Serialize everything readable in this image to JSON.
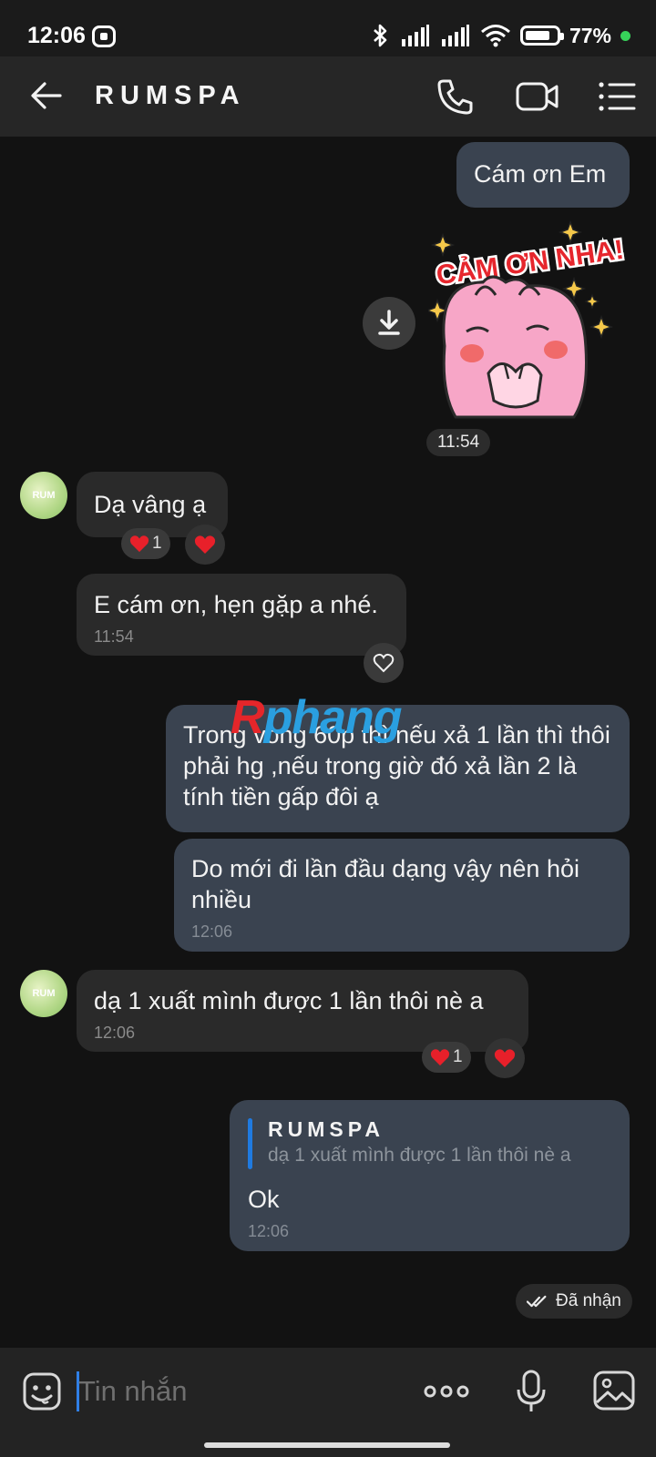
{
  "status_bar": {
    "time": "12:06",
    "battery": "77%"
  },
  "header": {
    "title": "RUMSPA"
  },
  "messages": {
    "m1": {
      "text": "Cám ơn Em"
    },
    "sticker": {
      "text": "CẢM ƠN NHA!",
      "time": "11:54"
    },
    "m2": {
      "text": "Dạ vâng ạ",
      "reaction_count": "1"
    },
    "m3": {
      "text": "E cám ơn, hẹn gặp a nhé.",
      "time": "11:54"
    },
    "m4": {
      "text": "Trong vòng 60p thì nếu xả 1 lần thì thôi phải hg ,nếu trong giờ đó xả lần 2 là tính tiền gấp đôi ạ"
    },
    "m5": {
      "text": "Do mới đi lần đầu dạng vậy nên hỏi nhiều",
      "time": "12:06"
    },
    "m6": {
      "text": "dạ 1 xuất mình được 1 lần thôi nè a",
      "time": "12:06",
      "reaction_count": "1"
    },
    "m7": {
      "quote_sender": "RUMSPA",
      "quote_text": "dạ 1 xuất mình được 1 lần thôi nè a",
      "text": "Ok",
      "time": "12:06"
    }
  },
  "avatar_text": "RUM",
  "delivered": "Đã nhận",
  "watermark": {
    "first": "R",
    "rest": "phang"
  },
  "composer": {
    "placeholder": "Tin nhắn"
  },
  "colors": {
    "outgoing_bubble": "#3a4350",
    "incoming_bubble": "#2a2a2a",
    "accent": "#1f7ae0",
    "heart": "#e8202a"
  }
}
